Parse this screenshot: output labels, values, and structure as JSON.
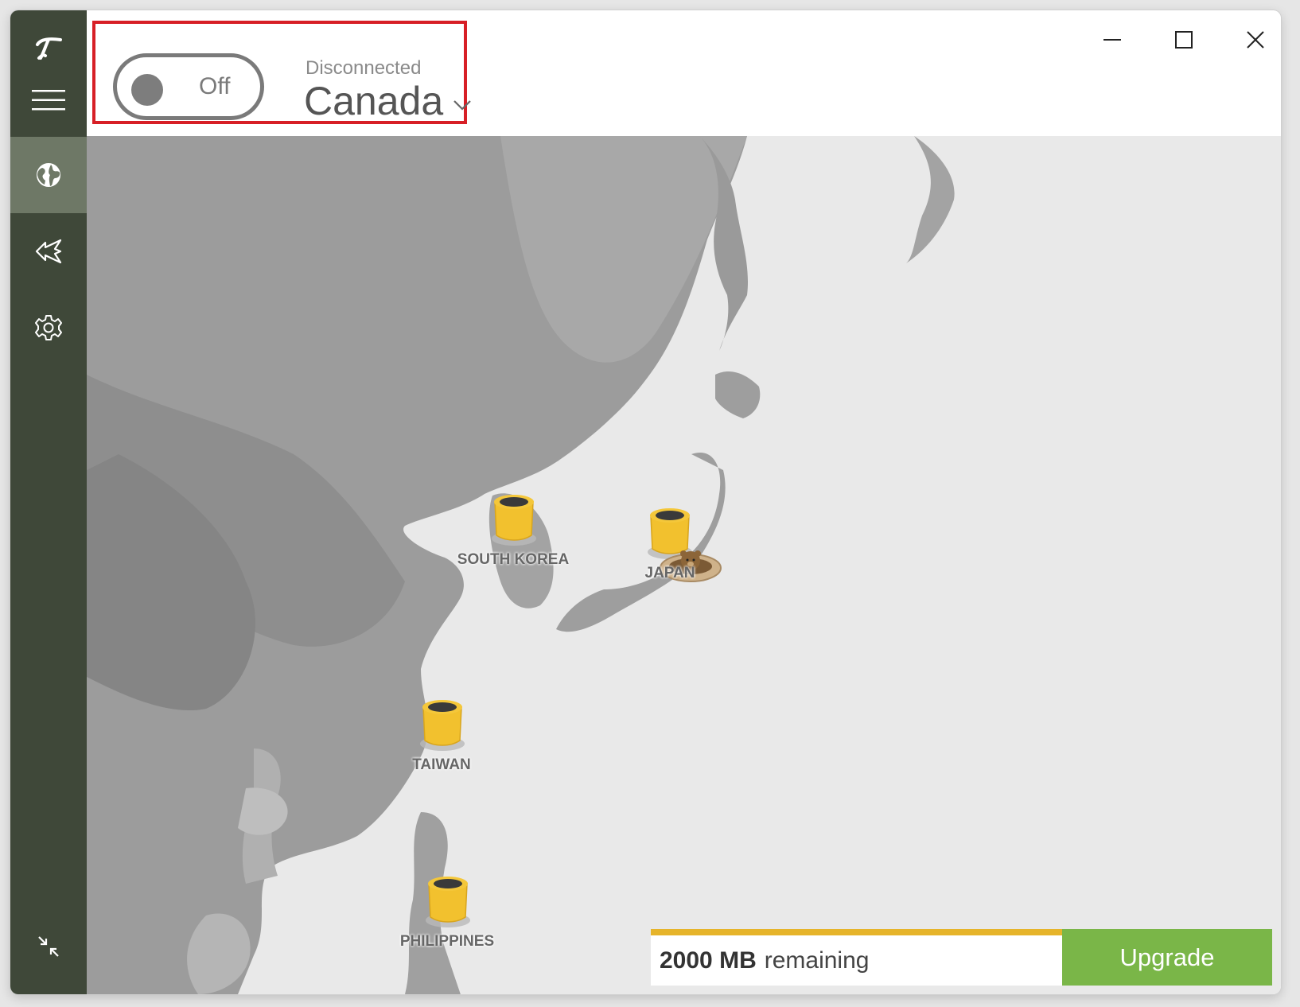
{
  "toggle": {
    "label": "Off",
    "state": "off"
  },
  "status": {
    "text": "Disconnected",
    "location": "Canada"
  },
  "map": {
    "countries": [
      {
        "label": "SOUTH KOREA"
      },
      {
        "label": "JAPAN"
      },
      {
        "label": "TAIWAN"
      },
      {
        "label": "PHILIPPINES"
      }
    ]
  },
  "data_usage": {
    "amount": "2000 MB",
    "suffix": "remaining",
    "upgrade_label": "Upgrade"
  },
  "colors": {
    "sidebar": "#3f4839",
    "sidebar_active": "#6e7866",
    "highlight": "#d71f26",
    "upgrade": "#7ab648",
    "usage_bar": "#e6b42a",
    "barrel": "#f2c12e"
  }
}
